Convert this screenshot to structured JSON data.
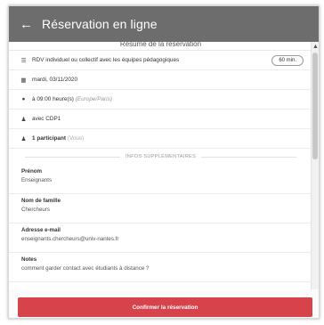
{
  "header": {
    "back_icon": "arrow-left-icon",
    "back_glyph": "←",
    "title": "Réservation en ligne"
  },
  "summary": {
    "title": "Résumé de la réservation",
    "appointment": {
      "icon": "list-icon",
      "text": "RDV individuel ou collectif avec les équipes pédagogiques",
      "duration": "60 min."
    },
    "date": {
      "icon": "calendar-icon",
      "text": "mardi, 03/11/2020"
    },
    "time": {
      "icon": "clock-icon",
      "text": "à 09:00 heure(s)",
      "timezone": "(Europe/Paris)"
    },
    "with": {
      "icon": "user-icon",
      "text": "avec CDP1"
    },
    "participants": {
      "icon": "users-icon",
      "text": "1 participant",
      "note": "(Vous)"
    }
  },
  "extra": {
    "section_label": "INFOS SUPPLÉMENTAIRES",
    "fields": [
      {
        "label": "Prénom",
        "value": "Enseignants"
      },
      {
        "label": "Nom de famille",
        "value": "Chercheurs"
      },
      {
        "label": "Adresse e-mail",
        "value": "enseignants.chercheurs@univ-nantes.fr"
      },
      {
        "label": "Notes",
        "value": "comment garder contact avec étudiants à distance ?"
      }
    ]
  },
  "footer": {
    "confirm_label": "Confirmer la réservation"
  },
  "colors": {
    "header": "#6d6d6d",
    "confirm": "#d6434b"
  }
}
